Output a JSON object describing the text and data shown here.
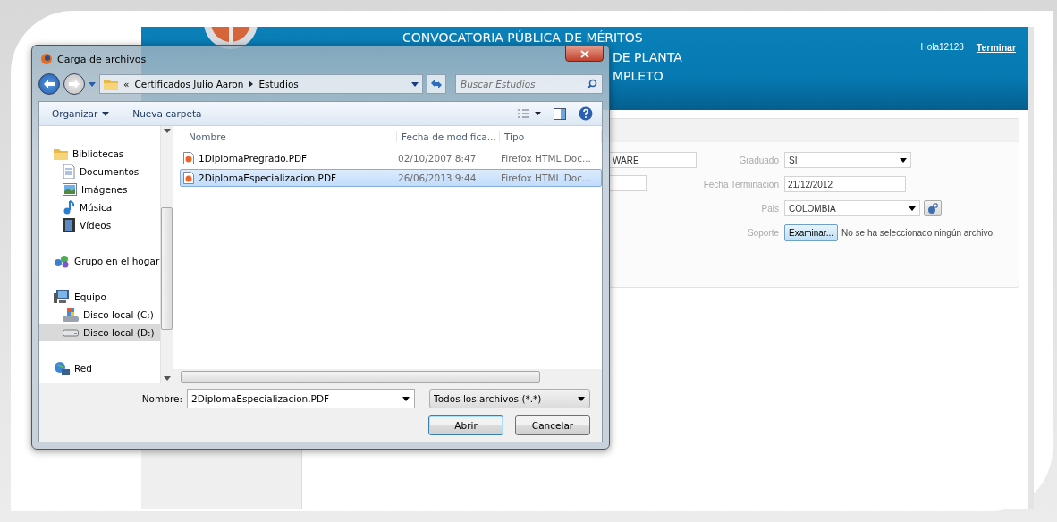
{
  "header": {
    "title_lines": [
      "CONVOCATORIA PÚBLICA DE MÉRITOS",
      "DE PLANTA",
      "MPLETO"
    ],
    "user": "Hola12123",
    "logout": "Terminar"
  },
  "form": {
    "left_fields": [
      {
        "kind": "text",
        "value": "WARE"
      },
      {
        "kind": "text"
      }
    ],
    "right_fields": [
      {
        "kind": "select",
        "label": "Graduado",
        "value": "SI"
      },
      {
        "kind": "text",
        "label": "Fecha Terminacion",
        "value": "21/12/2012"
      },
      {
        "kind": "select-button",
        "label": "Pais",
        "value": "COLOMBIA"
      },
      {
        "kind": "file",
        "label": "Soporte",
        "button": "Examinar...",
        "status": "No se ha seleccionado ningún archivo."
      }
    ]
  },
  "dialog": {
    "title": "Carga de archivos",
    "breadcrumb": [
      "«",
      "Certificados Julio Aaron",
      "Estudios"
    ],
    "search": {
      "placeholder": "Buscar Estudios"
    },
    "toolbar": [
      {
        "label": "Organizar",
        "menu": true
      },
      {
        "label": "Nueva carpeta",
        "menu": false
      }
    ],
    "nav": [
      {
        "label": "Bibliotecas",
        "kind": "folder",
        "selected": false,
        "children": [
          {
            "label": "Documentos",
            "kind": "document",
            "selected": false
          },
          {
            "label": "Imágenes",
            "kind": "image",
            "selected": false
          },
          {
            "label": "Música",
            "kind": "music",
            "selected": false
          },
          {
            "label": "Vídeos",
            "kind": "video",
            "selected": false
          }
        ]
      },
      {
        "label": "Grupo en el hogar",
        "kind": "homegroup",
        "selected": false
      },
      {
        "label": "Equipo",
        "kind": "computer",
        "selected": false,
        "children": [
          {
            "label": "Disco local (C:)",
            "kind": "system-disk",
            "selected": false
          },
          {
            "label": "Disco local (D:)",
            "kind": "disk",
            "selected": true
          }
        ]
      },
      {
        "label": "Red",
        "kind": "network",
        "selected": false
      }
    ],
    "columns": [
      "Nombre",
      "Fecha de modifica...",
      "Tipo"
    ],
    "files": [
      {
        "name": "1DiplomaPregrado.PDF",
        "date": "02/10/2007 8:47",
        "type": "Firefox HTML Doc...",
        "selected": false
      },
      {
        "name": "2DiplomaEspecializacion.PDF",
        "date": "26/06/2013 9:44",
        "type": "Firefox HTML Doc...",
        "selected": true
      }
    ],
    "filename_label": "Nombre:",
    "filename": "2DiplomaEspecializacion.PDF",
    "filter": "Todos los archivos (*.*)",
    "buttons": [
      {
        "label": "Abrir",
        "default": true
      },
      {
        "label": "Cancelar",
        "default": false
      }
    ]
  }
}
